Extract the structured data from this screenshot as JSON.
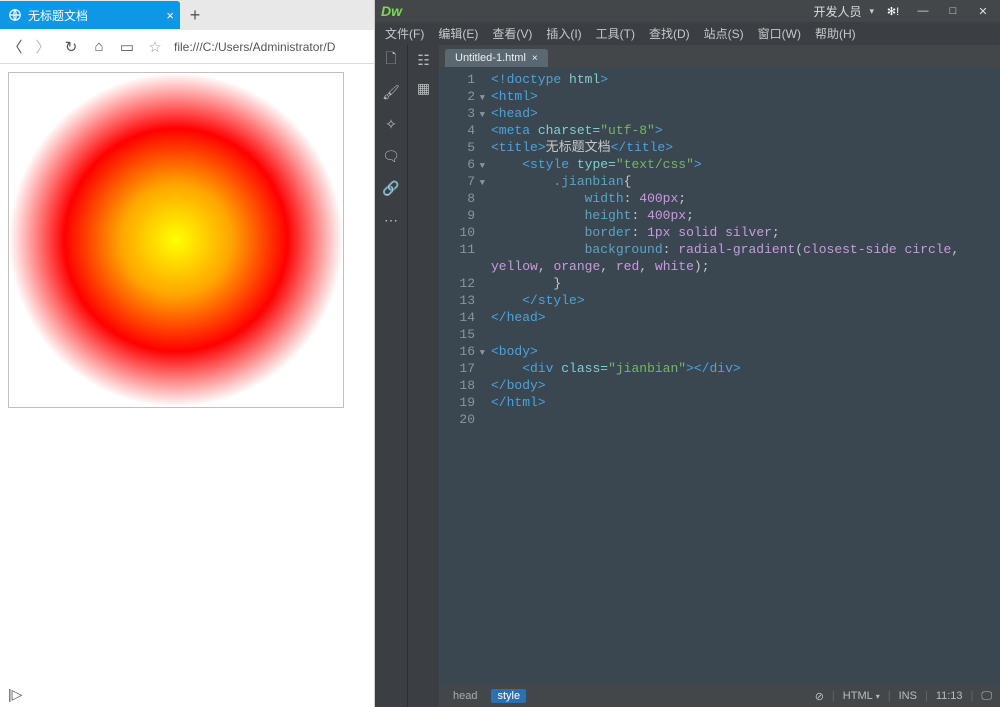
{
  "browser": {
    "tab": {
      "title": "无标题文档"
    },
    "address": "file:///C:/Users/Administrator/D",
    "footer_glyph": "|▷"
  },
  "dw": {
    "logo": "Dw",
    "role": "开发人员",
    "role_arrow": "▾",
    "gear": "✻!",
    "win": {
      "min": "—",
      "max": "□",
      "close": "✕"
    },
    "menus": [
      "文件(F)",
      "编辑(E)",
      "查看(V)",
      "插入(I)",
      "工具(T)",
      "查找(D)",
      "站点(S)",
      "窗口(W)",
      "帮助(H)"
    ],
    "file_tab": "Untitled-1.html",
    "file_tab_close": "×",
    "code": {
      "lines": [
        {
          "n": "1",
          "fold": "",
          "html": "<span class='tok-tag'>&lt;!doctype</span> <span class='tok-attr'>html</span><span class='tok-tag'>&gt;</span>"
        },
        {
          "n": "2",
          "fold": "▼",
          "html": "<span class='tok-tag'>&lt;html&gt;</span>"
        },
        {
          "n": "3",
          "fold": "▼",
          "html": "<span class='tok-tag'>&lt;head&gt;</span>"
        },
        {
          "n": "4",
          "fold": "",
          "html": "<span class='tok-tag'>&lt;meta</span> <span class='tok-attr'>charset=</span><span class='tok-str'>\"utf-8\"</span><span class='tok-tag'>&gt;</span>"
        },
        {
          "n": "5",
          "fold": "",
          "html": "<span class='tok-tag'>&lt;title&gt;</span><span class='tok-text'>无标题文档</span><span class='tok-tag'>&lt;/title&gt;</span>"
        },
        {
          "n": "6",
          "fold": "▼",
          "html": "    <span class='tok-tag'>&lt;style</span> <span class='tok-attr'>type=</span><span class='tok-str'>\"text/css\"</span><span class='tok-tag'>&gt;</span>"
        },
        {
          "n": "7",
          "fold": "▼",
          "html": "        <span class='tok-prop'>.jianbian</span><span class='tok-punc'>{</span>"
        },
        {
          "n": "8",
          "fold": "",
          "html": "            <span class='tok-prop'>width</span><span class='tok-punc'>:</span> <span class='tok-num'>400px</span><span class='tok-punc'>;</span>"
        },
        {
          "n": "9",
          "fold": "",
          "html": "            <span class='tok-prop'>height</span><span class='tok-punc'>:</span> <span class='tok-num'>400px</span><span class='tok-punc'>;</span>"
        },
        {
          "n": "10",
          "fold": "",
          "html": "            <span class='tok-prop'>border</span><span class='tok-punc'>:</span> <span class='tok-num'>1px</span> <span class='tok-val'>solid</span> <span class='tok-val'>silver</span><span class='tok-punc'>;</span>"
        },
        {
          "n": "11",
          "fold": "",
          "html": "            <span class='tok-prop'>background</span><span class='tok-punc'>:</span> <span class='tok-val'>radial-gradient</span><span class='tok-punc'>(</span><span class='tok-val'>closest-side</span> <span class='tok-val'>circle</span><span class='tok-punc'>,</span>\n<span class='tok-val'>yellow</span><span class='tok-punc'>,</span> <span class='tok-val'>orange</span><span class='tok-punc'>,</span> <span class='tok-val'>red</span><span class='tok-punc'>,</span> <span class='tok-val'>white</span><span class='tok-punc'>);</span>"
        },
        {
          "n": "12",
          "fold": "",
          "html": "        <span class='tok-punc'>}</span>"
        },
        {
          "n": "13",
          "fold": "",
          "html": "    <span class='tok-tag'>&lt;/style&gt;</span>"
        },
        {
          "n": "14",
          "fold": "",
          "html": "<span class='tok-tag'>&lt;/head&gt;</span>"
        },
        {
          "n": "15",
          "fold": "",
          "html": ""
        },
        {
          "n": "16",
          "fold": "▼",
          "html": "<span class='tok-tag'>&lt;body&gt;</span>"
        },
        {
          "n": "17",
          "fold": "",
          "html": "    <span class='tok-tag'>&lt;div</span> <span class='tok-attr'>class=</span><span class='tok-str'>\"jianbian\"</span><span class='tok-tag'>&gt;&lt;/div&gt;</span>"
        },
        {
          "n": "18",
          "fold": "",
          "html": "<span class='tok-tag'>&lt;/body&gt;</span>"
        },
        {
          "n": "19",
          "fold": "",
          "html": "<span class='tok-tag'>&lt;/html&gt;</span>"
        },
        {
          "n": "20",
          "fold": "",
          "html": ""
        }
      ]
    },
    "status": {
      "crumbs": [
        "head",
        "style"
      ],
      "lang": "HTML",
      "ins": "INS",
      "pos": "11:13"
    }
  }
}
